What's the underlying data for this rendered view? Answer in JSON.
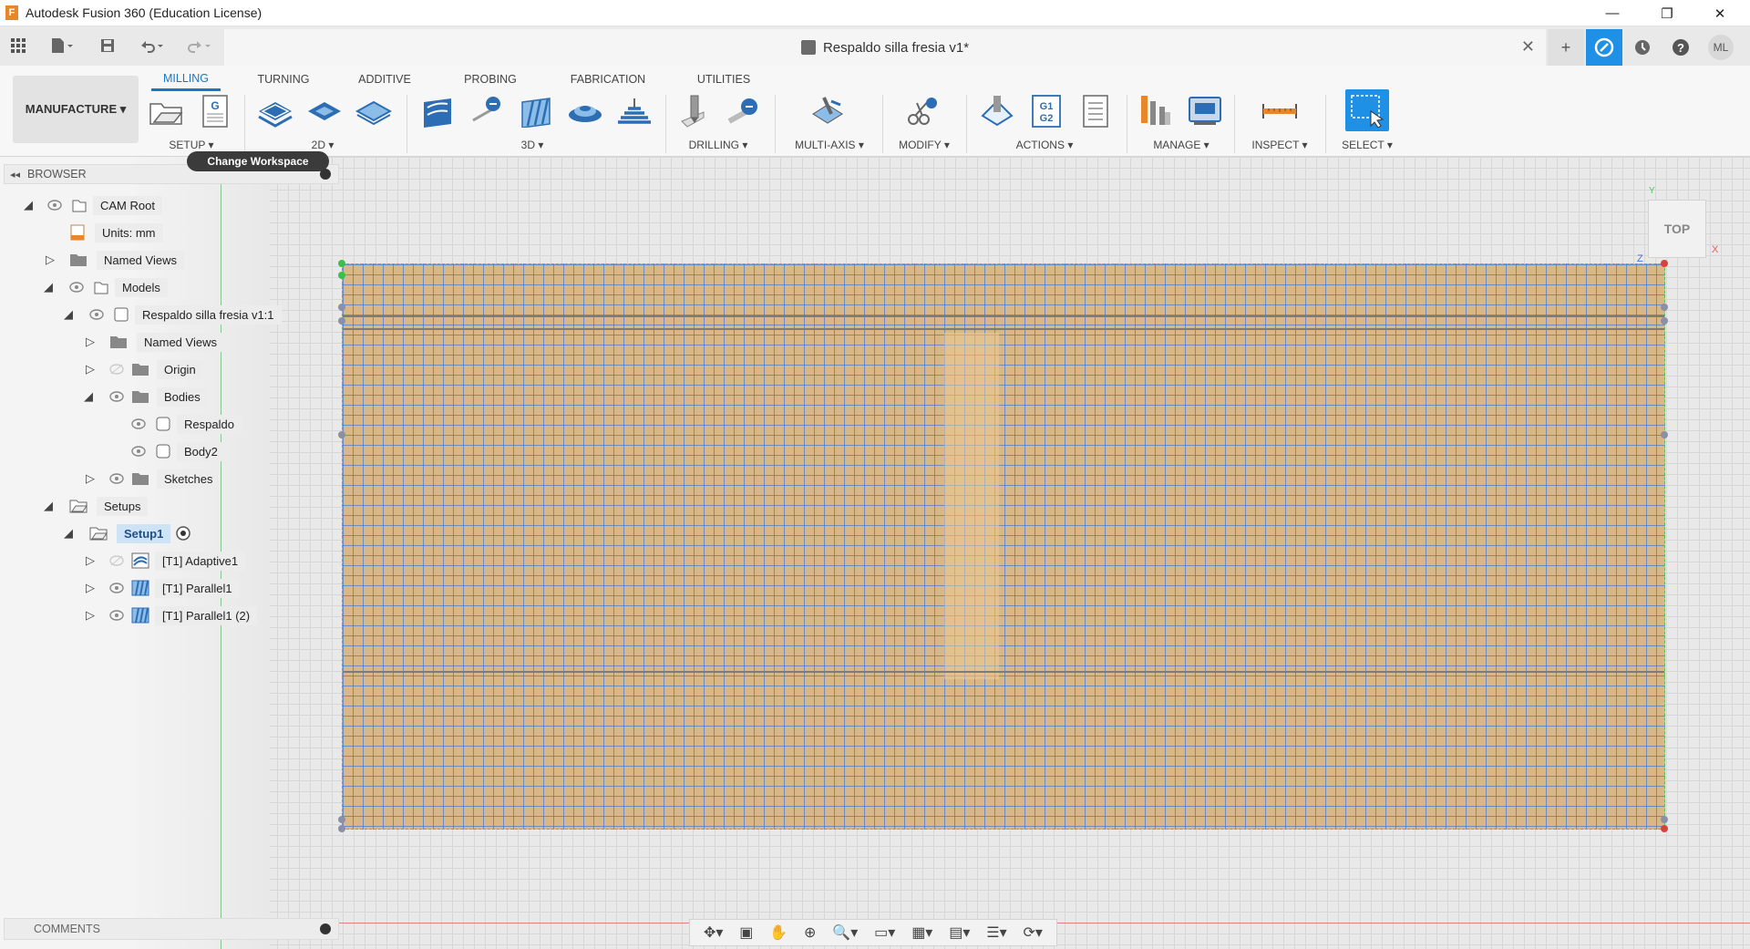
{
  "window": {
    "title": "Autodesk Fusion 360 (Education License)",
    "app_icon_letter": "F",
    "minimize_glyph": "—",
    "maximize_glyph": "❐",
    "close_glyph": "✕"
  },
  "document": {
    "tab_title": "Respaldo silla fresia v1*",
    "close_glyph": "✕"
  },
  "header_right": {
    "add_glyph": "+",
    "user_initials": "ML"
  },
  "workspace": {
    "label": "MANUFACTURE ▾",
    "tooltip": "Change Workspace"
  },
  "ribbon_tabs": [
    {
      "label": "MILLING",
      "active": true
    },
    {
      "label": "TURNING"
    },
    {
      "label": "ADDITIVE"
    },
    {
      "label": "PROBING"
    },
    {
      "label": "FABRICATION"
    },
    {
      "label": "UTILITIES"
    }
  ],
  "ribbon_groups": {
    "setup": "SETUP ▾",
    "twod": "2D ▾",
    "threed": "3D ▾",
    "drilling": "DRILLING ▾",
    "multiaxis": "MULTI-AXIS ▾",
    "modify": "MODIFY ▾",
    "actions": "ACTIONS ▾",
    "manage": "MANAGE ▾",
    "inspect": "INSPECT ▾",
    "select": "SELECT ▾"
  },
  "ribbon_tool_text": {
    "nc_program": "G",
    "post_process_line1": "G1",
    "post_process_line2": "G2"
  },
  "browser": {
    "title": "BROWSER",
    "items": [
      {
        "label": "CAM Root"
      },
      {
        "label": "Units: mm"
      },
      {
        "label": "Named Views"
      },
      {
        "label": "Models"
      },
      {
        "label": "Respaldo silla fresia v1:1"
      },
      {
        "label": "Named Views"
      },
      {
        "label": "Origin"
      },
      {
        "label": "Bodies"
      },
      {
        "label": "Respaldo"
      },
      {
        "label": "Body2"
      },
      {
        "label": "Sketches"
      },
      {
        "label": "Setups"
      },
      {
        "label": "Setup1"
      },
      {
        "label": "[T1] Adaptive1"
      },
      {
        "label": "[T1] Parallel1"
      },
      {
        "label": "[T1] Parallel1 (2)"
      }
    ]
  },
  "comments": {
    "title": "COMMENTS"
  },
  "viewcube": {
    "face": "TOP",
    "axis_x": "X",
    "axis_y": "Y",
    "axis_z": "Z"
  },
  "navbar": {
    "glyphs": [
      "✥▾",
      "▣",
      "✋",
      "⊕",
      "🔍▾",
      "▭▾",
      "▦▾",
      "▤▾",
      "☰▾",
      "⟳▾"
    ]
  },
  "colors": {
    "accent": "#1a76c4",
    "stock": "#d9b787",
    "toolpath_grid": "#3c78dc",
    "stock_boundary": "#55c06a"
  }
}
